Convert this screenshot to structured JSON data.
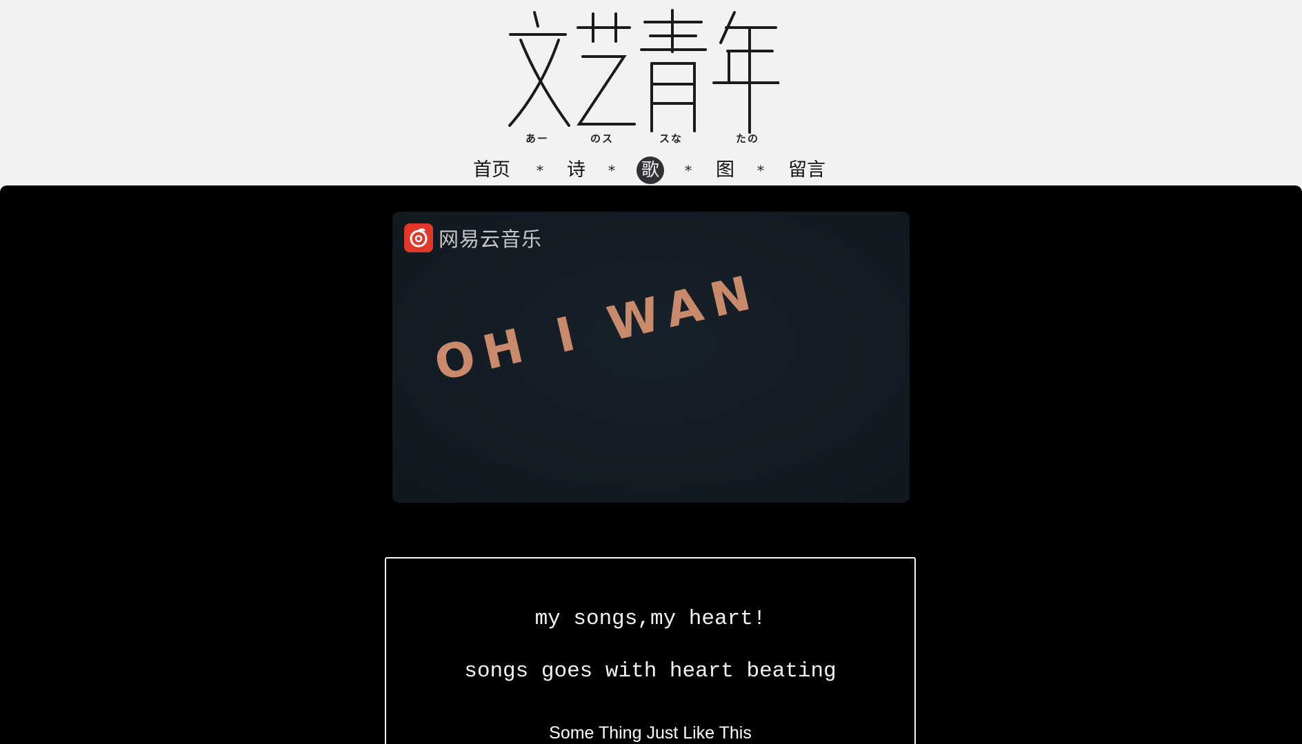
{
  "header": {
    "logo_text": "文艺青年",
    "logo_subs": [
      "あー",
      "のス",
      "スな",
      "たの"
    ]
  },
  "nav": {
    "items": [
      "首页",
      "诗",
      "歌",
      "图",
      "留言"
    ],
    "separator": "*",
    "active": "歌"
  },
  "player": {
    "brand_name": "网易云音乐",
    "video_text": "OH I WAN"
  },
  "card": {
    "line1": "my songs,my heart!",
    "line2": "songs goes with heart beating",
    "song_title": "Some Thing Just Like This"
  },
  "colors": {
    "page_background": "#f3f2f3",
    "main_background": "#000000",
    "nav_active_bg": "#2f3137",
    "brand_red": "#e0392b",
    "video_text_color": "#c98a6c"
  }
}
